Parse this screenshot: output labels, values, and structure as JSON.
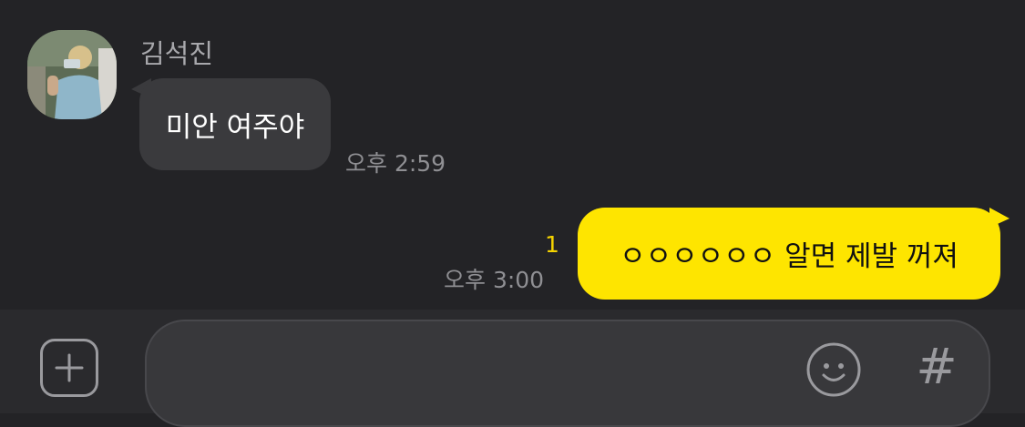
{
  "chat": {
    "incoming": {
      "sender_name": "김석진",
      "message": "미안 여주야",
      "time": "오후 2:59"
    },
    "outgoing": {
      "message": "ㅇㅇㅇㅇㅇㅇ 알면 제발 꺼져",
      "unread_count": "1",
      "time": "오후 3:00"
    }
  },
  "input_bar": {
    "placeholder": "",
    "plus_icon": "plus-square-icon",
    "emoji_icon": "smiley-icon",
    "hashtag_icon": "#"
  },
  "colors": {
    "background": "#232326",
    "incoming_bubble": "#3a3a3d",
    "outgoing_bubble": "#fee500",
    "unread_count": "#f5d300"
  }
}
